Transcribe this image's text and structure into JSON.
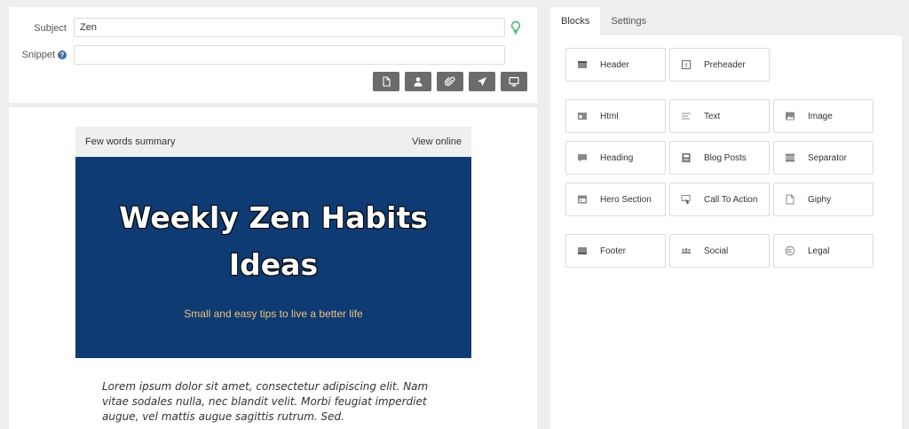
{
  "subject": {
    "label": "Subject",
    "value": "Zen"
  },
  "snippet": {
    "label": "Snippet",
    "help_glyph": "?",
    "value": ""
  },
  "toolbar": {
    "buttons": [
      "document-icon",
      "user-icon",
      "attachment-icon",
      "send-icon",
      "monitor-icon"
    ]
  },
  "email": {
    "preheader_left": "Few words summary",
    "preheader_right": "View online",
    "hero_title_line1": "Weekly Zen Habits",
    "hero_title_line2": "Ideas",
    "hero_subtitle": "Small and easy tips to live a better life",
    "body": "Lorem ipsum dolor sit amet, consectetur adipiscing elit. Nam vitae sodales nulla, nec blandit velit. Morbi feugiat imperdiet augue, vel mattis augue sagittis rutrum. Sed."
  },
  "tabs": [
    {
      "label": "Blocks",
      "active": true
    },
    {
      "label": "Settings",
      "active": false
    }
  ],
  "blocks": [
    {
      "label": "Header",
      "icon": "header-icon"
    },
    {
      "label": "Preheader",
      "icon": "preheader-icon"
    },
    {
      "label": "Html",
      "icon": "html-icon"
    },
    {
      "label": "Text",
      "icon": "text-icon"
    },
    {
      "label": "Image",
      "icon": "image-icon"
    },
    {
      "label": "Heading",
      "icon": "heading-icon"
    },
    {
      "label": "Blog Posts",
      "icon": "blog-posts-icon"
    },
    {
      "label": "Separator",
      "icon": "separator-icon"
    },
    {
      "label": "Hero Section",
      "icon": "hero-section-icon"
    },
    {
      "label": "Call To Action",
      "icon": "call-to-action-icon"
    },
    {
      "label": "Giphy",
      "icon": "giphy-icon"
    },
    {
      "label": "Footer",
      "icon": "footer-icon"
    },
    {
      "label": "Social",
      "icon": "social-icon"
    },
    {
      "label": "Legal",
      "icon": "legal-icon"
    }
  ],
  "colors": {
    "hero_bg": "#0e3b73",
    "hero_subtitle": "#f0c27b",
    "toolbar_button": "#6b6b6b",
    "bulb": "#3cb371"
  }
}
